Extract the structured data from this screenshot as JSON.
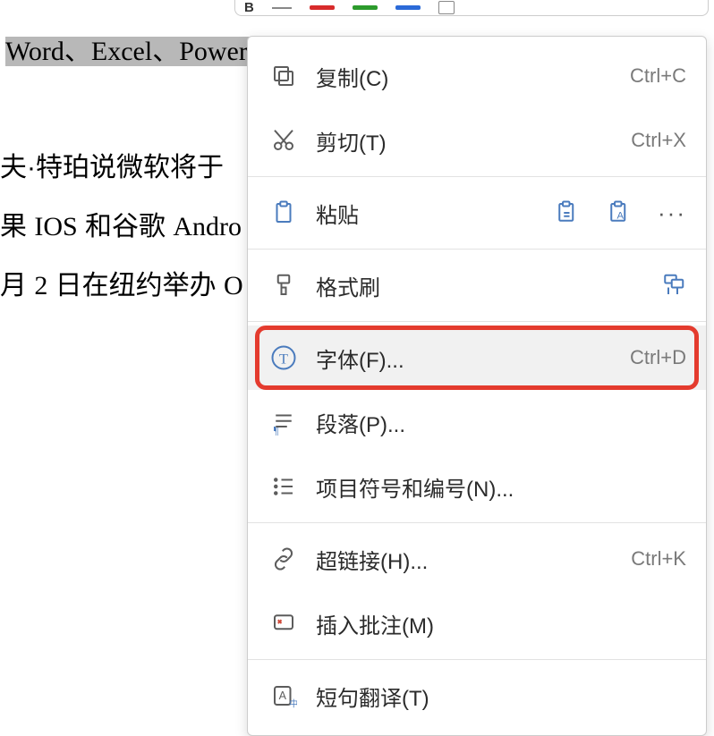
{
  "document": {
    "line1_highlight": "Word、Excel、PowerP",
    "line2": "夫·特珀说微软将于",
    "line3_pre": "果 ",
    "line3_ios": "IOS",
    "line3_mid": " 和谷歌 ",
    "line3_andr": "Andro",
    "line4_pre": "月 ",
    "line4_num": "2",
    "line4_mid": " 日在纽约举办 ",
    "line4_o": "O"
  },
  "menu": {
    "copy": {
      "label": "复制(C)",
      "shortcut": "Ctrl+C"
    },
    "cut": {
      "label": "剪切(T)",
      "shortcut": "Ctrl+X"
    },
    "paste": {
      "label": "粘贴"
    },
    "format_brush": {
      "label": "格式刷"
    },
    "font": {
      "label": "字体(F)...",
      "shortcut": "Ctrl+D"
    },
    "paragraph": {
      "label": "段落(P)..."
    },
    "bullets": {
      "label": "项目符号和编号(N)..."
    },
    "hyperlink": {
      "label": "超链接(H)...",
      "shortcut": "Ctrl+K"
    },
    "comment": {
      "label": "插入批注(M)"
    },
    "translate": {
      "label": "短句翻译(T)"
    }
  }
}
